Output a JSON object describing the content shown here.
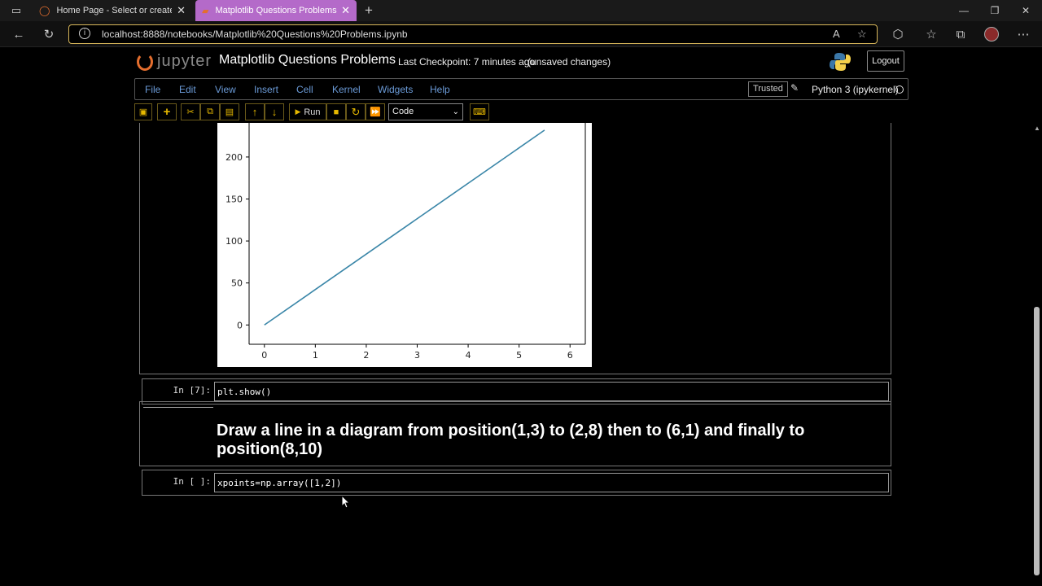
{
  "browser": {
    "tabs": [
      {
        "title": "Home Page - Select or create a n",
        "active": false
      },
      {
        "title": "Matplotlib Questions Problems",
        "active": true
      }
    ],
    "url": "localhost:8888/notebooks/Matplotlib%20Questions%20Problems.ipynb"
  },
  "jupyter": {
    "logo_text": "jupyter",
    "notebook_title": "Matplotlib Questions Problems",
    "checkpoint": "Last Checkpoint: 7 minutes ago",
    "unsaved": "(unsaved changes)",
    "logout_label": "Logout",
    "menu": [
      "File",
      "Edit",
      "View",
      "Insert",
      "Cell",
      "Kernel",
      "Widgets",
      "Help"
    ],
    "trusted": "Trusted",
    "kernel": "Python 3 (ipykernel)",
    "toolbar": {
      "run_label": "Run",
      "cell_type": "Code"
    }
  },
  "cells": {
    "show_cell": {
      "prompt": "In [7]:",
      "code": "plt.show()"
    },
    "markdown_heading": "Draw a line in a diagram from position(1,3) to (2,8) then to (6,1) and finally to position(8,10)",
    "input_cell": {
      "prompt": "In [ ]:",
      "code": "xpoints=np.array([1,2])"
    }
  },
  "chart_data": {
    "type": "line",
    "x": [
      0,
      5.5
    ],
    "y": [
      0,
      232
    ],
    "xlim": [
      -0.3,
      6.3
    ],
    "ylim": [
      -23,
      260
    ],
    "xticks": [
      0,
      1,
      2,
      3,
      4,
      5,
      6
    ],
    "yticks": [
      0,
      50,
      100,
      150,
      200
    ],
    "line_color": "#3a86a8",
    "grid": false
  },
  "colors": {
    "accent_tab": "#b46ac9",
    "address_border": "#d8b75a",
    "menu_link": "#6b9bd8",
    "toolbar_icon": "#e6b800"
  }
}
